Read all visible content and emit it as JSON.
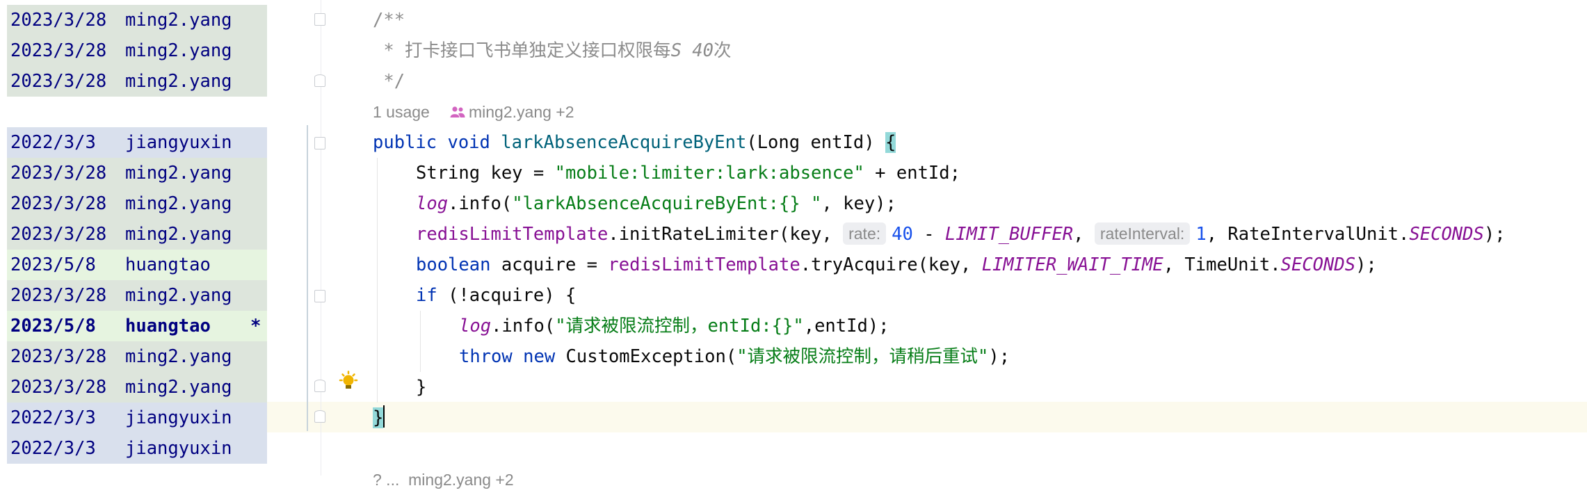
{
  "annotations": [
    {
      "date": "2023/3/28",
      "author": "ming2.yang",
      "marker": "",
      "bg": "#dde5dc",
      "bold": false
    },
    {
      "date": "2023/3/28",
      "author": "ming2.yang",
      "marker": "",
      "bg": "#dde5dc",
      "bold": false
    },
    {
      "date": "2023/3/28",
      "author": "ming2.yang",
      "marker": "",
      "bg": "#dde5dc",
      "bold": false
    },
    null,
    {
      "date": "2022/3/3",
      "author": "jiangyuxin",
      "marker": "",
      "bg": "#d9e0ed",
      "bold": false
    },
    {
      "date": "2023/3/28",
      "author": "ming2.yang",
      "marker": "",
      "bg": "#dde5dc",
      "bold": false
    },
    {
      "date": "2023/3/28",
      "author": "ming2.yang",
      "marker": "",
      "bg": "#dde5dc",
      "bold": false
    },
    {
      "date": "2023/3/28",
      "author": "ming2.yang",
      "marker": "",
      "bg": "#dde5dc",
      "bold": false
    },
    {
      "date": "2023/5/8",
      "author": "huangtao",
      "marker": "",
      "bg": "#e6f4e0",
      "bold": false
    },
    {
      "date": "2023/3/28",
      "author": "ming2.yang",
      "marker": "",
      "bg": "#dde5dc",
      "bold": false
    },
    {
      "date": "2023/5/8",
      "author": "huangtao",
      "marker": "*",
      "bg": "#e6f4e0",
      "bold": true
    },
    {
      "date": "2023/3/28",
      "author": "ming2.yang",
      "marker": "",
      "bg": "#dde5dc",
      "bold": false
    },
    {
      "date": "2023/3/28",
      "author": "ming2.yang",
      "marker": "",
      "bg": "#dde5dc",
      "bold": false
    },
    {
      "date": "2022/3/3",
      "author": "jiangyuxin",
      "marker": "",
      "bg": "#d9e0ed",
      "bold": false
    },
    {
      "date": "2022/3/3",
      "author": "jiangyuxin",
      "marker": "",
      "bg": "#d9e0ed",
      "bold": false
    }
  ],
  "code_lines": [
    {
      "indent": 0,
      "tokens": [
        {
          "t": "/**",
          "c": "cmt"
        }
      ]
    },
    {
      "indent": 0,
      "tokens": [
        {
          "t": " * 打卡接口飞书单独定义接口权限每",
          "c": "cmt"
        },
        {
          "t": "S 40",
          "c": "cmt-i"
        },
        {
          "t": "次",
          "c": "cmt"
        }
      ]
    },
    {
      "indent": 0,
      "tokens": [
        {
          "t": " */",
          "c": "cmt"
        }
      ]
    },
    {
      "lens": true
    },
    {
      "indent": 0,
      "tokens": [
        {
          "t": "public ",
          "c": "kw"
        },
        {
          "t": "void ",
          "c": "kw"
        },
        {
          "t": "larkAbsenceAcquireByEnt",
          "c": "mdecl"
        },
        {
          "t": "(Long entId) ",
          "c": ""
        },
        {
          "t": "{",
          "c": "brace-hl"
        }
      ]
    },
    {
      "indent": 1,
      "tokens": [
        {
          "t": "String key = ",
          "c": ""
        },
        {
          "t": "\"mobile:limiter:lark:absence\"",
          "c": "str"
        },
        {
          "t": " + entId;",
          "c": ""
        }
      ]
    },
    {
      "indent": 1,
      "tokens": [
        {
          "t": "log",
          "c": "sfld"
        },
        {
          "t": ".info(",
          "c": ""
        },
        {
          "t": "\"larkAbsenceAcquireByEnt:{} \"",
          "c": "str"
        },
        {
          "t": ", key);",
          "c": ""
        }
      ]
    },
    {
      "indent": 1,
      "tokens": [
        {
          "t": "redisLimitTemplate",
          "c": "fld"
        },
        {
          "t": ".initRateLimiter(key, ",
          "c": ""
        },
        {
          "t": "rate:",
          "c": "hint"
        },
        {
          "t": "40",
          "c": "num"
        },
        {
          "t": " - ",
          "c": ""
        },
        {
          "t": "LIMIT_BUFFER",
          "c": "sfld"
        },
        {
          "t": ", ",
          "c": ""
        },
        {
          "t": "rateInterval:",
          "c": "hint"
        },
        {
          "t": "1",
          "c": "num"
        },
        {
          "t": ", RateIntervalUnit.",
          "c": ""
        },
        {
          "t": "SECONDS",
          "c": "sfld"
        },
        {
          "t": ");",
          "c": ""
        }
      ]
    },
    {
      "indent": 1,
      "tokens": [
        {
          "t": "boolean ",
          "c": "kw"
        },
        {
          "t": "acquire = ",
          "c": ""
        },
        {
          "t": "redisLimitTemplate",
          "c": "fld"
        },
        {
          "t": ".tryAcquire(key, ",
          "c": ""
        },
        {
          "t": "LIMITER_WAIT_TIME",
          "c": "sfld"
        },
        {
          "t": ", TimeUnit.",
          "c": ""
        },
        {
          "t": "SECONDS",
          "c": "sfld"
        },
        {
          "t": ");",
          "c": ""
        }
      ]
    },
    {
      "indent": 1,
      "tokens": [
        {
          "t": "if ",
          "c": "kw"
        },
        {
          "t": "(!acquire) {",
          "c": ""
        }
      ]
    },
    {
      "indent": 2,
      "tokens": [
        {
          "t": "log",
          "c": "sfld"
        },
        {
          "t": ".info(",
          "c": ""
        },
        {
          "t": "\"请求被限流控制，entId:{}\"",
          "c": "str"
        },
        {
          "t": ",entId);",
          "c": ""
        }
      ]
    },
    {
      "indent": 2,
      "tokens": [
        {
          "t": "throw ",
          "c": "kw"
        },
        {
          "t": "new ",
          "c": "kw"
        },
        {
          "t": "CustomException(",
          "c": ""
        },
        {
          "t": "\"请求被限流控制，请稍后重试\"",
          "c": "str"
        },
        {
          "t": ");",
          "c": ""
        }
      ]
    },
    {
      "indent": 1,
      "tokens": [
        {
          "t": "}",
          "c": ""
        }
      ]
    },
    {
      "indent": 0,
      "tokens": [
        {
          "t": "}",
          "c": "brace-hl"
        },
        {
          "t": "",
          "c": "caret"
        }
      ]
    },
    {
      "indent": 0,
      "tokens": []
    }
  ],
  "code_lens": {
    "usages": "1 usage",
    "authors_icon": "people-icon",
    "authors": "ming2.yang +2",
    "bottom_partial": "? ...  ming2.yang +2"
  },
  "colors": {
    "keyword": "#0033b3",
    "string": "#067d17",
    "number": "#1750eb",
    "field": "#871094",
    "method_decl": "#00627a",
    "comment": "#8c8c8c",
    "annotation_text": "#000080",
    "current_line": "#fcfaed",
    "brace_match": "#93d9d9"
  }
}
